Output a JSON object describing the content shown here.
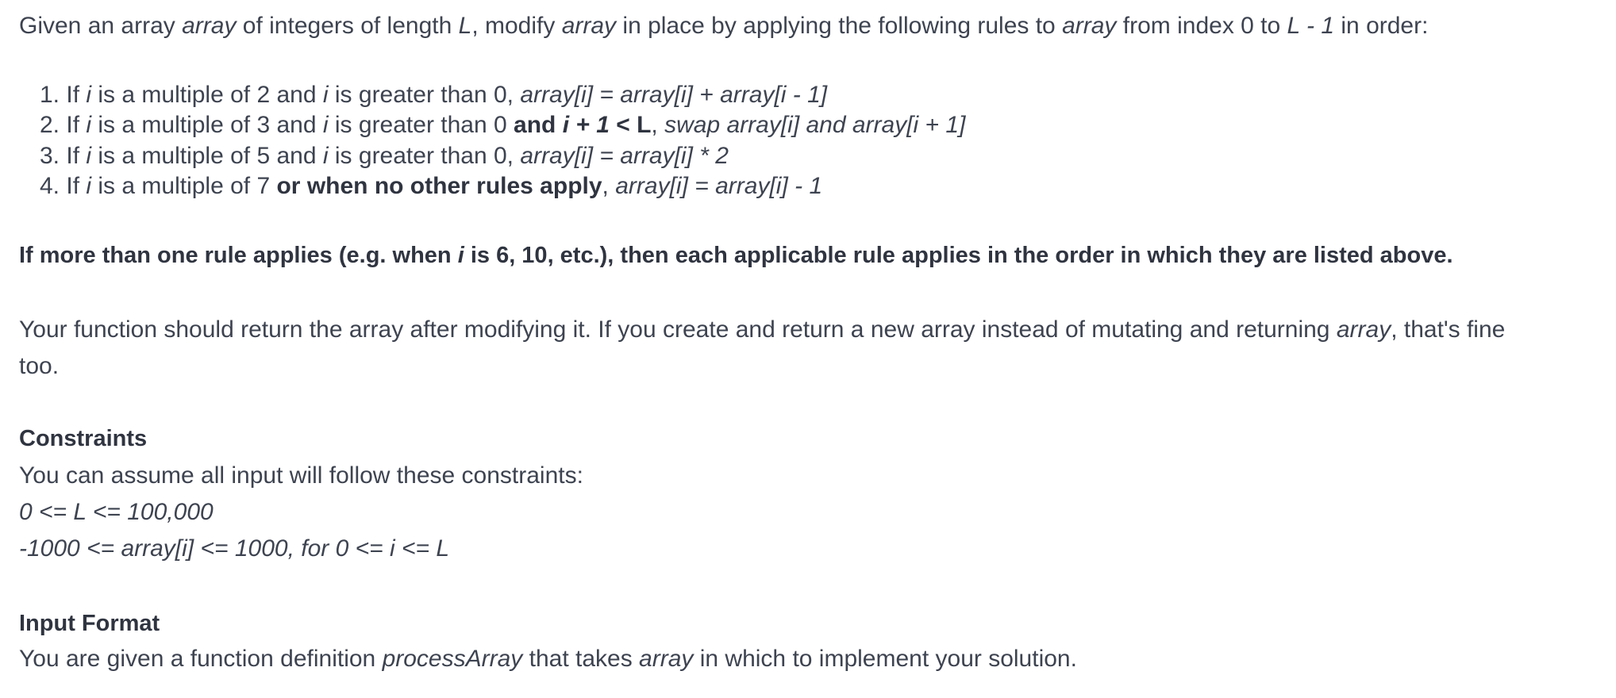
{
  "intro": {
    "s1": "Given an array ",
    "s2": "array",
    "s3": " of integers of length ",
    "s4": "L",
    "s5": ", modify ",
    "s6": "array",
    "s7": " in place by applying the following rules to ",
    "s8": "array",
    "s9": " from index 0 to ",
    "s10": "L - 1",
    "s11": " in order:"
  },
  "rules": [
    {
      "n": "1. ",
      "a": "If ",
      "i": "i",
      "b": " is a multiple of 2 and ",
      "i2": "i",
      "c": " is greater than 0, ",
      "expr": "array[i] = array[i] + array[i - 1]"
    },
    {
      "n": "2. ",
      "a": "If ",
      "i": "i",
      "b": " is a multiple of 3 and ",
      "i2": "i",
      "c": " is greater than 0 ",
      "bold1": "and ",
      "bold_i": "i + 1",
      "bold2": " < L",
      ",": ", ",
      "expr": "swap array[i] and array[i + 1]"
    },
    {
      "n": "3. ",
      "a": "If ",
      "i": "i",
      "b": " is a multiple of 5 and ",
      "i2": "i",
      "c": " is greater than 0, ",
      "expr": "array[i] = array[i] * 2"
    },
    {
      "n": "4. ",
      "a": "If ",
      "i": "i",
      "b": " is a multiple of 7 ",
      "bold1": "or when no other rules apply",
      ",": ", ",
      "expr": "array[i] = array[i] - 1"
    }
  ],
  "note": {
    "s1": "If more than one rule applies (e.g. when ",
    "s2": "i",
    "s3": " is 6, 10, etc.), then each applicable rule applies in the order in which they are listed above."
  },
  "return_para": {
    "s1": "Your function should return the array after modifying it. If you create and return a new array instead of mutating and returning ",
    "s2": "array",
    "s3": ", that's fine",
    "s4": "too."
  },
  "constraints": {
    "heading": "Constraints",
    "intro": "You can assume all input will follow these constraints:",
    "c1": "0 <= L <= 100,000",
    "c2": "-1000 <= array[i] <= 1000, for 0 <= i <= L"
  },
  "input_format": {
    "heading": "Input Format",
    "s1": "You are given a function definition ",
    "s2": "processArray",
    "s3": " that takes ",
    "s4": "array",
    "s5": " in which to implement your solution."
  }
}
